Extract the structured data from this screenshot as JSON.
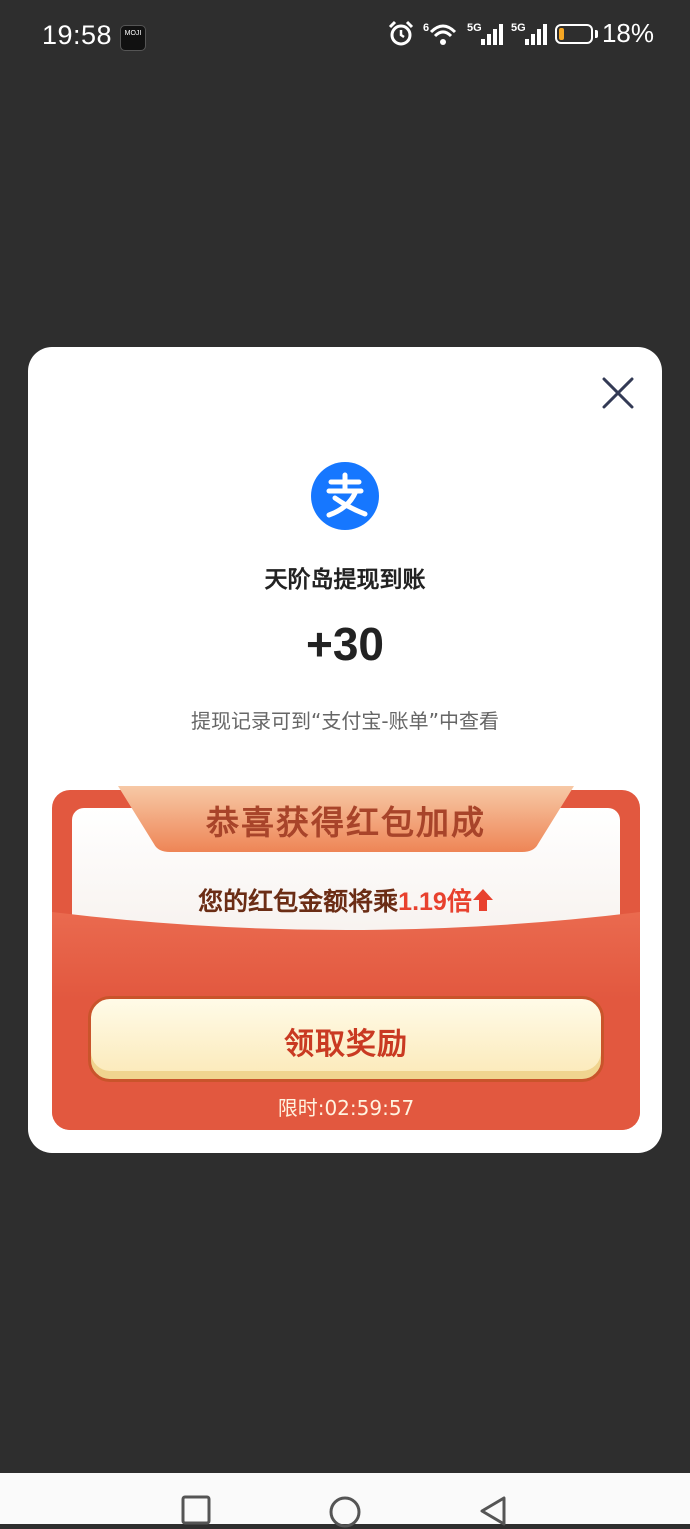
{
  "status_bar": {
    "time": "19:58",
    "app_badge": "MOJI",
    "wifi_label": "6",
    "sim1_label": "5G",
    "sim2_label": "5G",
    "battery": "18%",
    "battery_level": 0.18,
    "battery_color": "#f5a623"
  },
  "dialog": {
    "title": "天阶岛提现到账",
    "amount": "+30",
    "hint": "提现记录可到“支付宝-账单”中查看",
    "logo_glyph": "支",
    "logo_color": "#1677ff"
  },
  "bonus": {
    "heading": "恭喜获得红包加成",
    "subtitle_prefix": "您的红包金额将乘",
    "multiplier": "1.19倍",
    "button_label": "领取奖励",
    "timer": "限时:02:59:57",
    "accent": "#e2583f"
  },
  "nav": {
    "recent_icon": "square-icon",
    "home_icon": "circle-icon",
    "back_icon": "triangle-back-icon"
  }
}
